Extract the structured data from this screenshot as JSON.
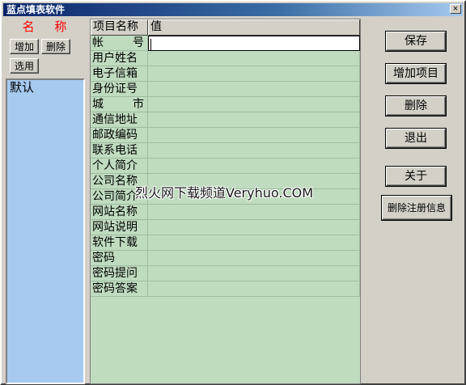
{
  "window": {
    "title": "蓝点填表软件",
    "close_label": "×"
  },
  "left": {
    "name_label": "名 称",
    "add_label": "增加",
    "delete_label": "删除",
    "select_label": "选用",
    "list_items": [
      "默认"
    ]
  },
  "grid": {
    "headers": [
      "项目名称",
      "值"
    ],
    "rows": [
      {
        "label": "帐 号",
        "value": ""
      },
      {
        "label": "用户姓名",
        "value": ""
      },
      {
        "label": "电子信箱",
        "value": ""
      },
      {
        "label": "身份证号",
        "value": ""
      },
      {
        "label": "城 市",
        "value": ""
      },
      {
        "label": "通信地址",
        "value": ""
      },
      {
        "label": "邮政编码",
        "value": ""
      },
      {
        "label": "联系电话",
        "value": ""
      },
      {
        "label": "个人简介",
        "value": ""
      },
      {
        "label": "公司名称",
        "value": ""
      },
      {
        "label": "公司简介",
        "value": ""
      },
      {
        "label": "网站名称",
        "value": ""
      },
      {
        "label": "网站说明",
        "value": ""
      },
      {
        "label": "软件下载",
        "value": ""
      },
      {
        "label": "密码",
        "value": ""
      },
      {
        "label": "密码提问",
        "value": ""
      },
      {
        "label": "密码答案",
        "value": ""
      }
    ]
  },
  "watermark": "烈火网下载频道Veryhuo.COM",
  "right": {
    "save_label": "保存",
    "add_item_label": "增加项目",
    "delete_label": "删除",
    "exit_label": "退出",
    "about_label": "关于",
    "delete_reg_label": "删除注册信息"
  }
}
